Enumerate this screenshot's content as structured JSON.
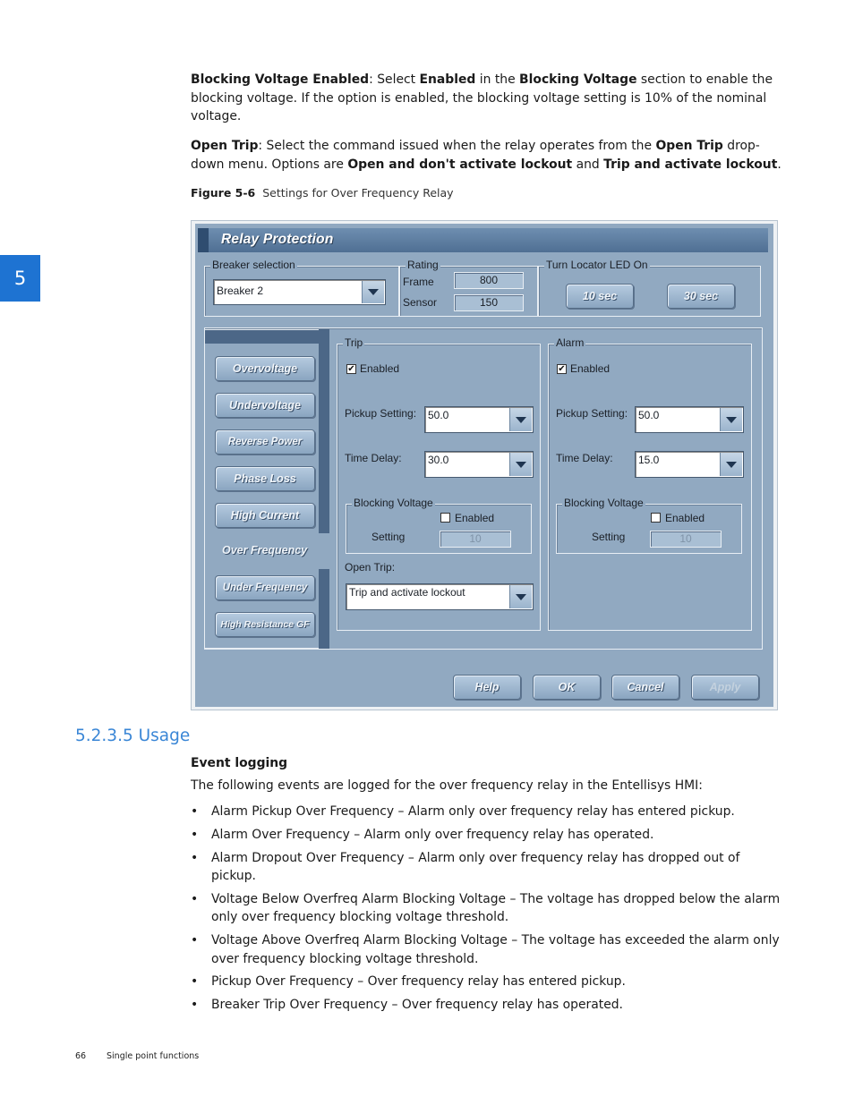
{
  "chapter_tab": "5",
  "intro": {
    "p1": {
      "term": "Blocking Voltage Enabled",
      "t1": ": Select ",
      "b1": "Enabled",
      "t2": " in the ",
      "b2": "Blocking Voltage",
      "t3": " section to enable the blocking voltage. If the option is enabled, the blocking voltage setting is 10% of the nominal voltage."
    },
    "p2": {
      "term": "Open Trip",
      "t1": ": Select the command issued when the relay operates from the ",
      "b1": "Open Trip",
      "t2": " drop-down menu. Options are ",
      "b2": "Open and don't activate lockout",
      "t3": " and ",
      "b3": "Trip and activate lockout",
      "t4": "."
    }
  },
  "figure": {
    "number": "Figure 5-6",
    "caption": "Settings for Over Frequency Relay"
  },
  "dialog": {
    "title": "Relay Protection",
    "breaker_selection": {
      "label": "Breaker selection",
      "value": "Breaker 2"
    },
    "rating": {
      "label": "Rating",
      "frame_label": "Frame",
      "frame_value": "800",
      "sensor_label": "Sensor",
      "sensor_value": "150"
    },
    "locator": {
      "label": "Turn Locator LED On",
      "btn_10": "10 sec",
      "btn_30": "30 sec"
    },
    "nav": [
      "Overvoltage",
      "Undervoltage",
      "Reverse Power",
      "Phase Loss",
      "High Current",
      "Over Frequency",
      "Under Frequency",
      "High Resistance GF"
    ],
    "nav_selected": "Over Frequency",
    "trip": {
      "label": "Trip",
      "enabled_label": "Enabled",
      "enabled": true,
      "pickup_label": "Pickup Setting:",
      "pickup_value": "50.0",
      "delay_label": "Time Delay:",
      "delay_value": "30.0",
      "bv_label": "Blocking Voltage",
      "bv_enabled_label": "Enabled",
      "bv_setting_label": "Setting",
      "bv_setting_value": "10",
      "open_trip_label": "Open Trip:",
      "open_trip_value": "Trip and activate lockout"
    },
    "alarm": {
      "label": "Alarm",
      "enabled_label": "Enabled",
      "enabled": true,
      "pickup_label": "Pickup Setting:",
      "pickup_value": "50.0",
      "delay_label": "Time Delay:",
      "delay_value": "15.0",
      "bv_label": "Blocking Voltage",
      "bv_enabled_label": "Enabled",
      "bv_setting_label": "Setting",
      "bv_setting_value": "10"
    },
    "buttons": {
      "help": "Help",
      "ok": "OK",
      "cancel": "Cancel",
      "apply": "Apply"
    }
  },
  "section": {
    "number": "5.2.3.5",
    "title": "Usage"
  },
  "event_logging": {
    "heading": "Event logging",
    "intro": "The following events are logged for the over frequency relay in the Entellisys HMI:",
    "items": [
      "Alarm Pickup Over Frequency – Alarm only over frequency relay has entered pickup.",
      "Alarm Over Frequency – Alarm only over frequency relay has operated.",
      "Alarm Dropout Over Frequency – Alarm only over frequency relay has dropped out of pickup.",
      "Voltage Below Overfreq Alarm Blocking Voltage – The voltage has dropped below the alarm only over frequency blocking voltage threshold.",
      "Voltage Above Overfreq Alarm Blocking Voltage – The voltage has exceeded the alarm only over frequency blocking voltage threshold.",
      "Pickup Over Frequency – Over frequency relay has entered pickup.",
      "Breaker Trip Over Frequency – Over frequency relay has operated."
    ]
  },
  "footer": {
    "page": "66",
    "title": "Single point functions"
  }
}
